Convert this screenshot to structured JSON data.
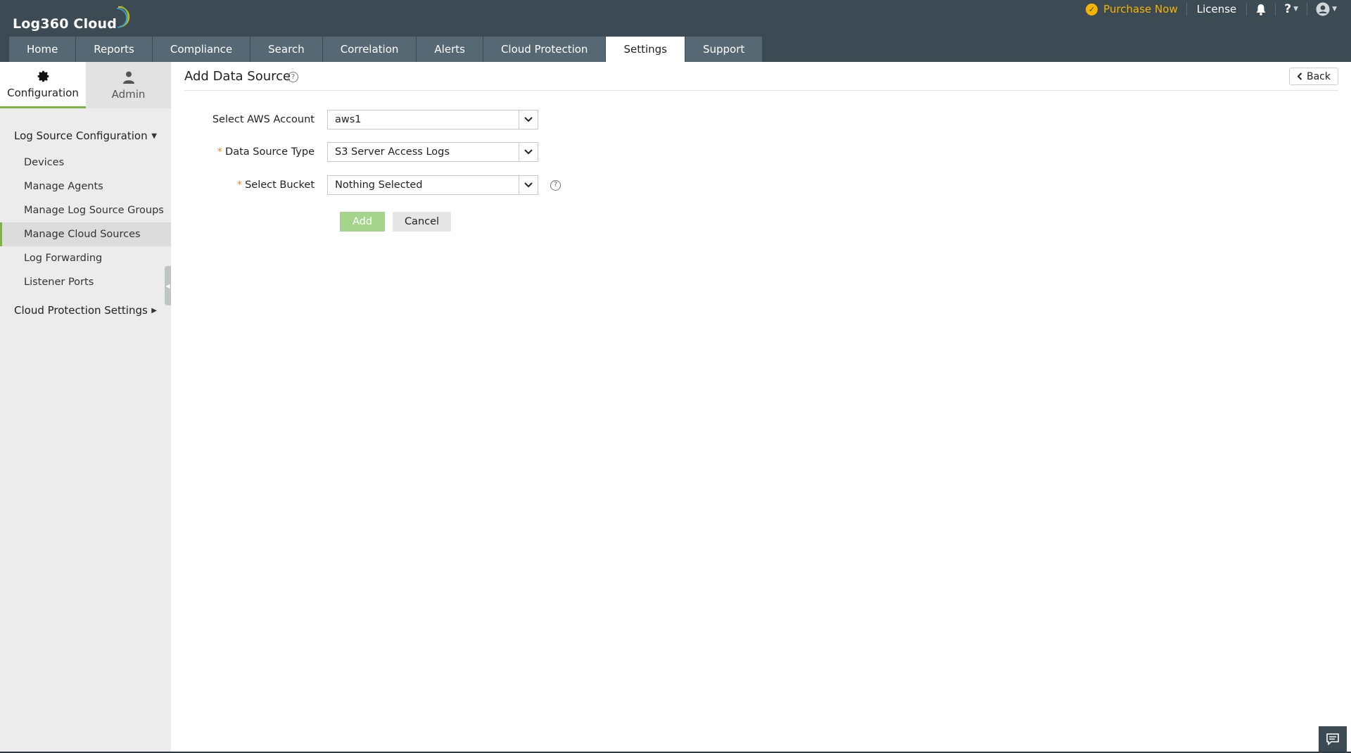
{
  "header": {
    "logo_text": "Log360 Cloud",
    "purchase_label": "Purchase Now",
    "license_label": "License",
    "help_glyph": "?"
  },
  "nav": {
    "tabs": [
      "Home",
      "Reports",
      "Compliance",
      "Search",
      "Correlation",
      "Alerts",
      "Cloud Protection",
      "Settings",
      "Support"
    ],
    "active": "Settings"
  },
  "sidebar": {
    "tabs": [
      {
        "label": "Configuration",
        "icon": "gear-icon",
        "active": true
      },
      {
        "label": "Admin",
        "icon": "user-icon",
        "active": false
      }
    ],
    "group1_label": "Log Source Configuration",
    "items": [
      "Devices",
      "Manage Agents",
      "Manage Log Source Groups",
      "Manage Cloud Sources",
      "Log Forwarding",
      "Listener Ports"
    ],
    "active_item": "Manage Cloud Sources",
    "group2_label": "Cloud Protection Settings"
  },
  "page": {
    "title": "Add Data Source",
    "back_label": "Back"
  },
  "form": {
    "aws_account_label": "Select AWS Account",
    "aws_account_value": "aws1",
    "data_source_type_label": "Data Source Type",
    "data_source_type_value": "S3 Server Access Logs",
    "bucket_label": "Select Bucket",
    "bucket_value": "Nothing Selected",
    "required_mark": "*",
    "add_label": "Add",
    "cancel_label": "Cancel"
  },
  "colors": {
    "topbar": "#3c4a54",
    "nav_tab": "#566874",
    "accent_green": "#7cb342",
    "purchase_yellow": "#f5b400"
  }
}
